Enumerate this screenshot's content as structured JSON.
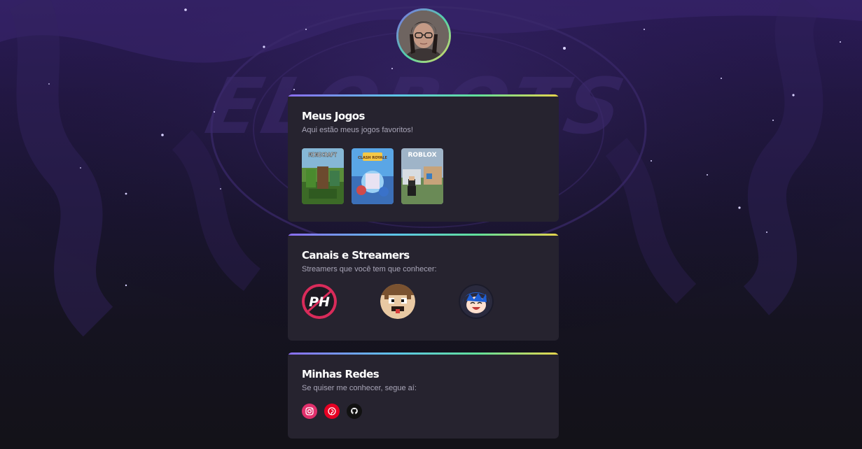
{
  "profile": {
    "avatar": "profile-photo"
  },
  "games_card": {
    "title": "Meus Jogos",
    "subtitle": "Aqui estão meus jogos favoritos!",
    "games": [
      {
        "name": "Minecraft",
        "logo_text": "MINECRAFT"
      },
      {
        "name": "Clash Royale",
        "logo_text": "CLASH ROYALE"
      },
      {
        "name": "Roblox",
        "logo_text": "ROBLOX"
      }
    ]
  },
  "streamers_card": {
    "title": "Canais e Streamers",
    "subtitle": "Streamers que você tem que conhecer:",
    "streamers": [
      {
        "name": "PH",
        "logo_text": "PH"
      },
      {
        "name": "pixel-face-streamer"
      },
      {
        "name": "blue-hair-streamer"
      }
    ]
  },
  "socials_card": {
    "title": "Minhas Redes",
    "subtitle": "Se quiser me conhecer, segue aí:",
    "links": [
      {
        "name": "Instagram",
        "icon": "instagram-icon",
        "color": "#e1306c"
      },
      {
        "name": "Pinterest",
        "icon": "pinterest-icon",
        "color": "#e60023"
      },
      {
        "name": "GitHub",
        "icon": "github-icon",
        "color": "#111111"
      }
    ]
  },
  "colors": {
    "card_bg": "#26232f",
    "accent_gradient": [
      "#8a6cf0",
      "#5cc6e8",
      "#61e09a",
      "#e8d64c"
    ]
  }
}
